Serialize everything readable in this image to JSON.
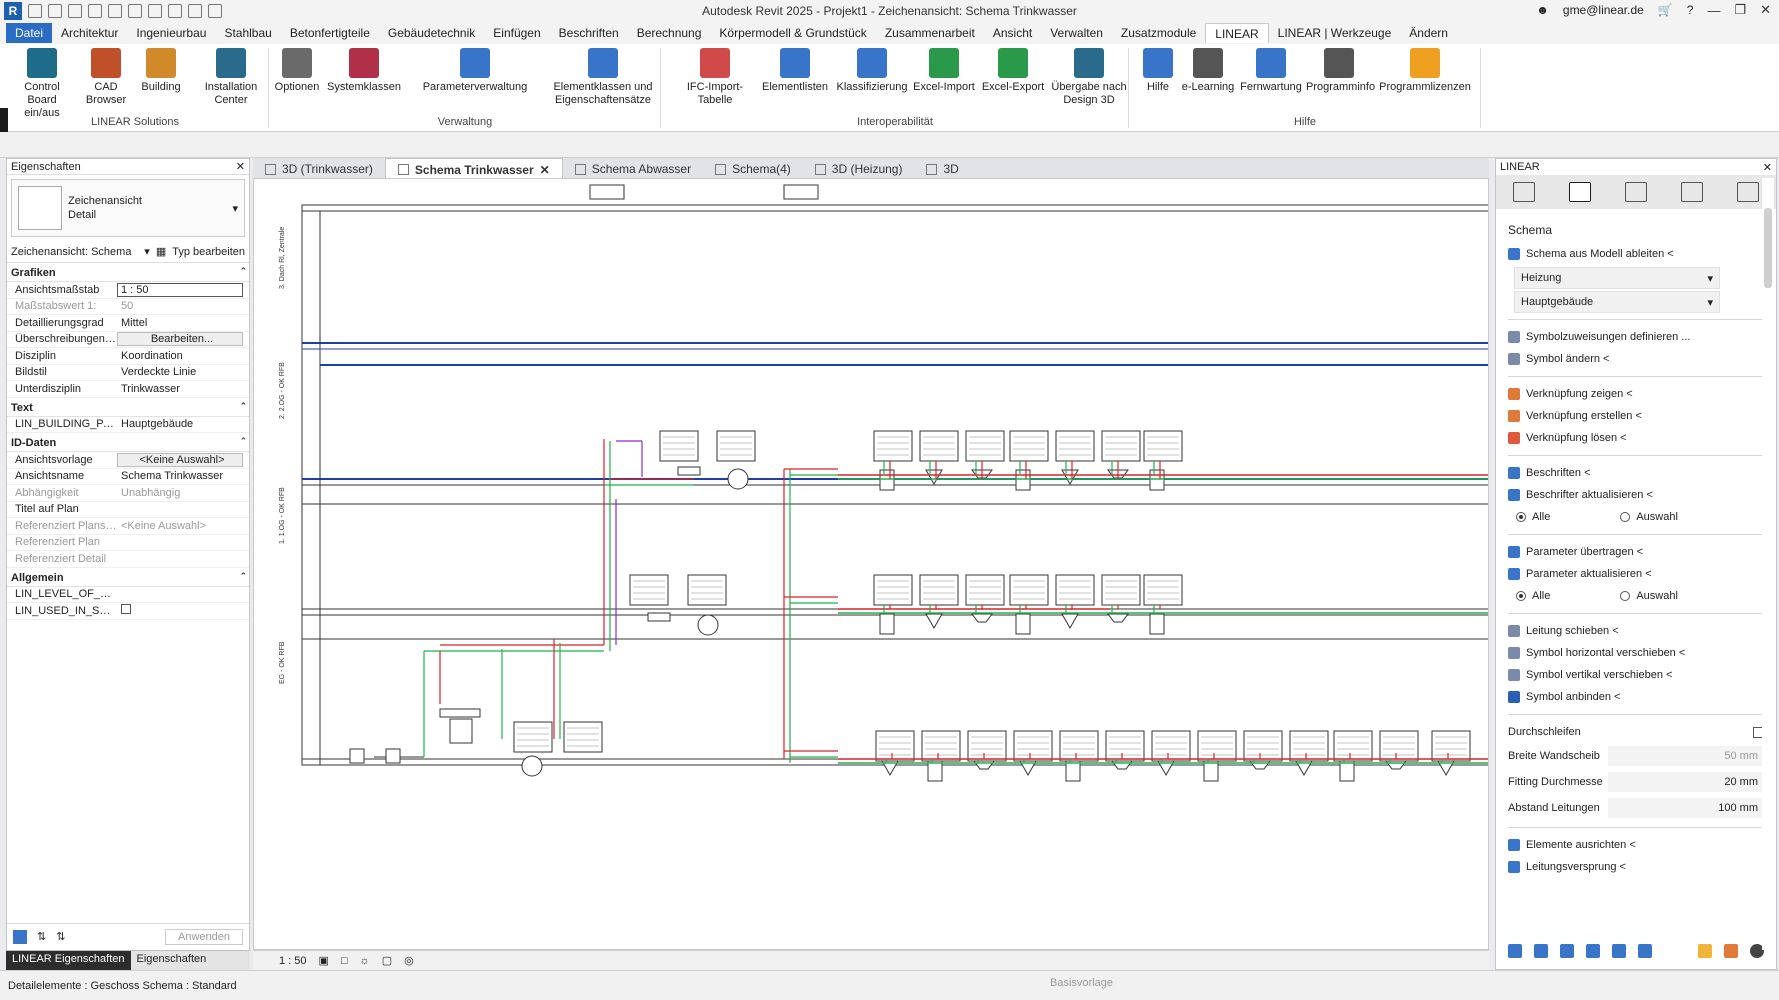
{
  "app": {
    "title": "Autodesk Revit 2025 - Projekt1 - Zeichenansicht: Schema Trinkwasser",
    "logo": "R",
    "user": "gme@linear.de"
  },
  "menu": {
    "tabs": [
      "Datei",
      "Architektur",
      "Ingenieurbau",
      "Stahlbau",
      "Betonfertigteile",
      "Gebäudetechnik",
      "Einfügen",
      "Beschriften",
      "Berechnung",
      "Körpermodell & Grundstück",
      "Zusammenarbeit",
      "Ansicht",
      "Verwalten",
      "Zusatzmodule",
      "LINEAR",
      "LINEAR | Werkzeuge",
      "Ändern"
    ],
    "active": "LINEAR"
  },
  "ribbon": {
    "groups": [
      {
        "label": "LINEAR Solutions",
        "buttons": [
          "Control Board ein/aus",
          "CAD Browser",
          "Building",
          "Installation Center"
        ]
      },
      {
        "label": "Verwaltung",
        "buttons": [
          "Optionen",
          "Systemklassen",
          "Parameterverwaltung",
          "Elementklassen und Eigenschaftensätze"
        ]
      },
      {
        "label": "Interoperabilität",
        "buttons": [
          "IFC-Import-Tabelle",
          "Elementlisten",
          "Klassifizierung",
          "Excel-Import",
          "Excel-Export",
          "Übergabe nach Design 3D"
        ]
      },
      {
        "label": "Hilfe",
        "buttons": [
          "Hilfe",
          "e-Learning",
          "Fernwartung",
          "Programminfo",
          "Programmlizenzen"
        ]
      }
    ]
  },
  "properties": {
    "title": "Eigenschaften",
    "type_line1": "Zeichenansicht",
    "type_line2": "Detail",
    "selector": "Zeichenansicht: Schema",
    "edit_type": "Typ bearbeiten",
    "categories": {
      "grafiken": "Grafiken",
      "text": "Text",
      "iddaten": "ID-Daten",
      "allgemein": "Allgemein"
    },
    "rows": {
      "massstab_k": "Ansichtsmaßstab",
      "massstab_v": "1 : 50",
      "massstabwert_k": "Maßstabswert 1:",
      "massstabwert_v": "50",
      "detail_k": "Detaillierungsgrad",
      "detail_v": "Mittel",
      "ueber_k": "Überschreibungen S...",
      "ueber_v": "Bearbeiten...",
      "disziplin_k": "Disziplin",
      "disziplin_v": "Koordination",
      "bildstil_k": "Bildstil",
      "bildstil_v": "Verdeckte Linie",
      "unter_k": "Unterdisziplin",
      "unter_v": "Trinkwasser",
      "building_k": "LIN_BUILDING_PART",
      "building_v": "Hauptgebäude",
      "vorlage_k": "Ansichtsvorlage",
      "vorlage_v": "<Keine Auswahl>",
      "name_k": "Ansichtsname",
      "name_v": "Schema Trinkwasser",
      "abh_k": "Abhängigkeit",
      "abh_v": "Unabhängig",
      "titel_k": "Titel auf Plan",
      "titel_v": "",
      "refpl_k": "Referenziert Plansa...",
      "refpl_v": "<Keine Auswahl>",
      "refplan_k": "Referenziert Plan",
      "refplan_v": "",
      "refdet_k": "Referenziert Detail",
      "refdet_v": "",
      "level_k": "LIN_LEVEL_OF_GEO...",
      "level_v": "",
      "used_k": "LIN_USED_IN_SHEETS",
      "used_v": ""
    },
    "apply": "Anwenden",
    "tabs": [
      "LINEAR Eigenschaften",
      "Eigenschaften"
    ]
  },
  "doctabs": [
    "3D (Trinkwasser)",
    "Schema Trinkwasser",
    "Schema Abwasser",
    "Schema(4)",
    "3D (Heizung)",
    "3D"
  ],
  "view": {
    "scale": "1 : 50",
    "levels": [
      "3. Dach Rl, Zentrale",
      "2. 2.OG - OK RFB",
      "1. 1.OG - OK RFB",
      "EG - OK RFB"
    ]
  },
  "linear_panel": {
    "title": "LINEAR",
    "section": "Schema",
    "derive": "Schema aus Modell ableiten <",
    "dropdown1": "Heizung",
    "dropdown2": "Hauptgebäude",
    "items": {
      "symdef": "Symbolzuweisungen definieren ...",
      "symchg": "Symbol ändern <",
      "linkshow": "Verknüpfung zeigen <",
      "linkcreate": "Verknüpfung erstellen <",
      "linkdel": "Verknüpfung lösen <",
      "label": "Beschriften <",
      "labelupd": "Beschrifter aktualisieren <",
      "paramtx": "Parameter übertragen <",
      "paramupd": "Parameter aktualisieren <",
      "pipemove": "Leitung schieben <",
      "symh": "Symbol horizontal verschieben <",
      "symv": "Symbol vertikal verschieben <",
      "symlink": "Symbol anbinden <",
      "align": "Elemente ausrichten <",
      "jump": "Leitungsversprung <"
    },
    "radio_all": "Alle",
    "radio_sel": "Auswahl",
    "loop": "Durchschleifen",
    "fields": {
      "wall_k": "Breite Wandscheib",
      "wall_v": "50 mm",
      "fit_k": "Fitting Durchmesse",
      "fit_v": "20 mm",
      "dist_k": "Abstand Leitungen",
      "dist_v": "100 mm"
    }
  },
  "status": {
    "left": "Detailelemente : Geschoss Schema : Standard",
    "mid": "Basisvorlage"
  },
  "colors": {
    "level_blue": "#1e3fa8",
    "pipe_green": "#22b24c",
    "pipe_red": "#d8232a",
    "pipe_purple": "#8a2bd9",
    "file_tab": "#2b6cc4"
  }
}
